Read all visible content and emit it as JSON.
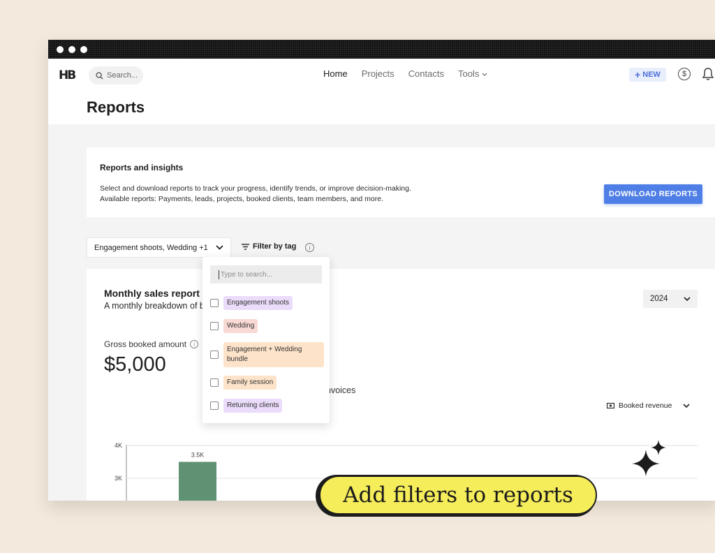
{
  "app": {
    "logo": "HB"
  },
  "nav": {
    "search_placeholder": "Search...",
    "links": [
      "Home",
      "Projects",
      "Contacts",
      "Tools"
    ],
    "new_label": "NEW",
    "dollar_symbol": "$"
  },
  "page": {
    "title": "Reports"
  },
  "insights": {
    "title": "Reports and insights",
    "desc_line1": "Select and download reports to track your progress, identify trends, or improve decision-making.",
    "desc_line2": "Available reports: Payments, leads, projects, booked clients, team members, and more.",
    "download_label": "DOWNLOAD REPORTS"
  },
  "filters": {
    "tag_select_value": "Engagement shoots, Wedding +1",
    "filter_by_tag_label": "Filter by tag",
    "info_symbol": "i"
  },
  "dropdown": {
    "search_placeholder": "Type to search...",
    "items": [
      {
        "label": "Engagement shoots",
        "color": "#eadcfa"
      },
      {
        "label": "Wedding",
        "color": "#f8d9d4"
      },
      {
        "label": "Engagement + Wedding bundle",
        "color": "#fde3c9"
      },
      {
        "label": "Family session",
        "color": "#fde3c9"
      },
      {
        "label": "Returning clients",
        "color": "#eadcfa"
      }
    ]
  },
  "report": {
    "title": "Monthly sales report",
    "subtitle": "A monthly breakdown of b",
    "year": "2024",
    "gross_label": "Gross booked amount",
    "gross_value": "$5,000",
    "invoices_text": "nvoices",
    "metric_select": "Booked revenue"
  },
  "chart_data": {
    "type": "bar",
    "y_ticks": [
      "4K",
      "3K"
    ],
    "ylim": [
      0,
      4000
    ],
    "values": [
      3500
    ],
    "data_labels": [
      "3.5K"
    ],
    "bar_color": "#5e9273"
  },
  "banner": {
    "text": "Add filters to reports"
  },
  "colors": {
    "accent": "#4f7fe6",
    "banner": "#f5ed5a",
    "background": "#f3e9dc"
  }
}
